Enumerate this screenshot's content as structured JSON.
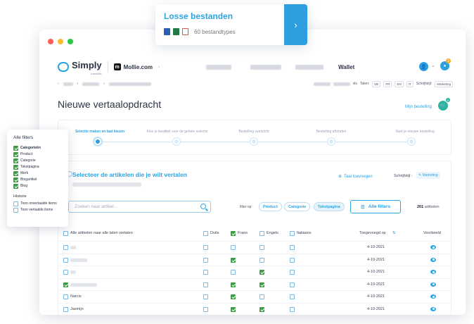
{
  "floating_card": {
    "title": "Losse bestanden",
    "count_label": "60 bestandtypes",
    "icons": [
      "word-icon",
      "excel-icon",
      "pdf-icon"
    ],
    "arrow": "›"
  },
  "header": {
    "logo_text": "Simply",
    "logo_sub": "translate",
    "store_initial": "m",
    "store_name": "Mollie.com",
    "nav_chevron": "›",
    "wallet": "Wallet",
    "avatar_chevron": "⌄",
    "notification_count": "3"
  },
  "subbar": {
    "langs_label": "Talen:",
    "langs": [
      "DE",
      "FR",
      "EN",
      "IT"
    ],
    "style_label": "Schrijfstijl:",
    "style_value": "Marketing",
    "suffix": "xls"
  },
  "page": {
    "title": "Nieuwe vertaalopdracht",
    "my_order": "Mijn bestelling",
    "cart_count": "0"
  },
  "steps": [
    {
      "label": "Selectie maken en taal kiezen",
      "active": true
    },
    {
      "label": "Kies je kwaliteit voor de gehele selectie",
      "active": false
    },
    {
      "label": "Bestelling overzicht",
      "active": false
    },
    {
      "label": "Bestelling afronden",
      "active": false
    },
    {
      "label": "Start je nieuwe bestelling",
      "active": false
    }
  ],
  "selection": {
    "title": "Selecteer de artikelen die je wilt vertalen",
    "add_language": "Taal toevoegen",
    "style_label": "Schrijfstijl :",
    "style_value": "Marketing",
    "search_placeholder": "Zoeken naar artikel...",
    "filter_on": "filter op",
    "chips": [
      {
        "label": "Product",
        "active": false
      },
      {
        "label": "Categorie",
        "active": false
      },
      {
        "label": "Tekstpagina",
        "active": true
      }
    ],
    "all_filters": "Alle filters",
    "result_count": "201",
    "result_label": "artikelen"
  },
  "table": {
    "headers": {
      "select_all": "Alle artikelen naar alle talen vertalen",
      "langs": [
        "Duits",
        "Frans",
        "Engels",
        "Italiaans"
      ],
      "added": "Toegevoegd op",
      "sort_icon": "⇅",
      "preview": "Voorbeeld"
    },
    "header_checks": [
      false,
      true,
      false,
      false
    ],
    "rows": [
      {
        "name": "",
        "row_checked": false,
        "checks": [
          false,
          false,
          false,
          false
        ],
        "date": "4-10-2021"
      },
      {
        "name": "",
        "row_checked": false,
        "checks": [
          false,
          true,
          false,
          false
        ],
        "date": "4-10-2021"
      },
      {
        "name": "",
        "row_checked": false,
        "checks": [
          false,
          false,
          true,
          false
        ],
        "date": "4-10-2021"
      },
      {
        "name": "",
        "row_checked": true,
        "checks": [
          false,
          true,
          true,
          false
        ],
        "date": "4-10-2021"
      },
      {
        "name": "Narcis",
        "row_checked": false,
        "checks": [
          false,
          true,
          false,
          false
        ],
        "date": "4-10-2021"
      },
      {
        "name": "Jasmijn",
        "row_checked": false,
        "checks": [
          false,
          true,
          true,
          false
        ],
        "date": "4-10-2021"
      }
    ]
  },
  "filter_panel": {
    "title": "Alle filters",
    "items": [
      {
        "label": "Categorieën",
        "checked": true,
        "bold": true
      },
      {
        "label": "Product",
        "checked": true,
        "bold": false
      },
      {
        "label": "Categorie",
        "checked": true,
        "bold": false
      },
      {
        "label": "Tekstpagina",
        "checked": true,
        "bold": false
      },
      {
        "label": "Merk",
        "checked": true,
        "bold": false
      },
      {
        "label": "Blogartikel",
        "checked": true,
        "bold": false
      },
      {
        "label": "Blog",
        "checked": true,
        "bold": false
      }
    ],
    "history_title": "Historie",
    "history_items": [
      {
        "label": "Toon onvertaalde items",
        "checked": false
      },
      {
        "label": "Toon vertaalde items",
        "checked": false
      }
    ]
  },
  "colors": {
    "accent": "#2ba4e3",
    "check_green": "#3e9c47",
    "cart_teal": "#2bb5a0"
  }
}
